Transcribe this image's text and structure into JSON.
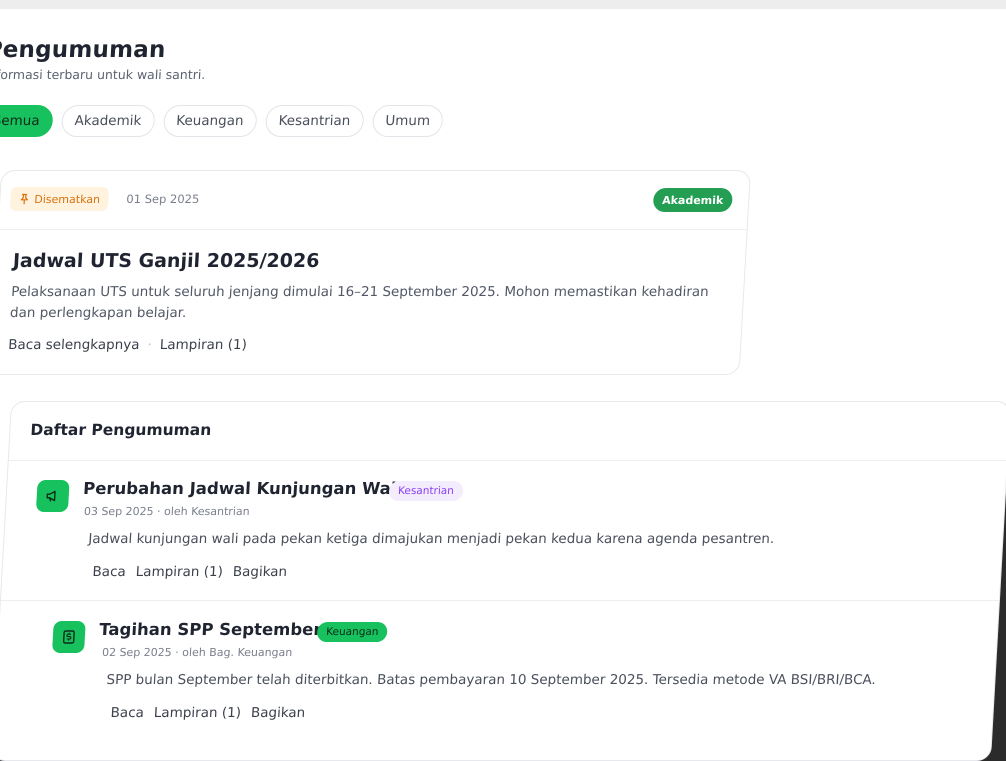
{
  "page": {
    "title": "Pengumuman",
    "subtitle": "Informasi terbaru untuk wali santri."
  },
  "filters": [
    "Semua",
    "Akademik",
    "Keuangan",
    "Kesantrian",
    "Umum"
  ],
  "active_filter": "Semua",
  "pinned": {
    "badge": "Disematkan",
    "date": "01 Sep 2025",
    "category": "Akademik",
    "title": "Jadwal UTS Ganjil 2025/2026",
    "body": "Pelaksanaan UTS untuk seluruh jenjang dimulai 16–21 September 2025. Mohon memastikan kehadiran dan perlengkapan belajar.",
    "read_more": "Baca selengkapnya",
    "separator": "·",
    "attachment": "Lampiran (1)"
  },
  "list": {
    "title": "Daftar Pengumuman",
    "items": [
      {
        "icon": "megaphone-icon",
        "title": "Perubahan Jadwal Kunjungan Wali",
        "category": "Kesantrian",
        "meta": "03 Sep 2025 · oleh Kesantrian",
        "body": "Jadwal kunjungan wali pada pekan ketiga dimajukan menjadi pekan kedua karena agenda pesantren.",
        "actions": [
          "Baca",
          "Lampiran (1)",
          "Bagikan"
        ]
      },
      {
        "icon": "invoice-icon",
        "title": "Tagihan SPP September",
        "category": "Keuangan",
        "meta": "02 Sep 2025 · oleh Bag. Keuangan",
        "body": "SPP bulan September telah diterbitkan. Batas pembayaran 10 September 2025. Tersedia metode VA BSI/BRI/BCA.",
        "actions": [
          "Baca",
          "Lampiran (1)",
          "Bagikan"
        ]
      }
    ]
  },
  "colors": {
    "accent_green": "#16c15e",
    "tag_green_dark": "#249e53",
    "pin_orange": "#d9730d",
    "tag_purple": "#8a3ff0"
  }
}
